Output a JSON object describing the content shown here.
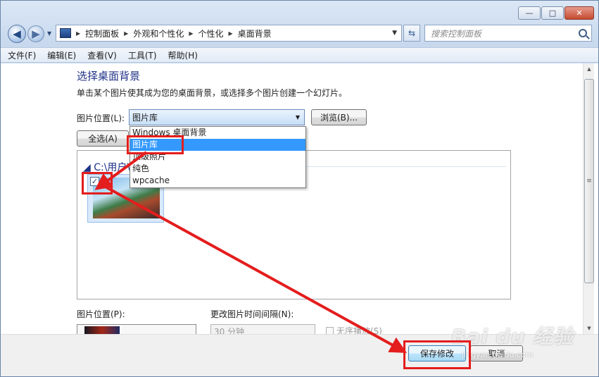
{
  "window": {
    "minimize_label": "—",
    "maximize_label": "□",
    "close_label": "✕"
  },
  "nav": {
    "breadcrumbs": [
      "控制面板",
      "外观和个性化",
      "个性化",
      "桌面背景"
    ],
    "search_placeholder": "搜索控制面板",
    "icons": [
      "back-arrow-icon",
      "forward-arrow-icon",
      "control-panel-icon",
      "refresh-icon",
      "search-icon"
    ]
  },
  "menu": [
    "文件(F)",
    "编辑(E)",
    "查看(V)",
    "工具(T)",
    "帮助(H)"
  ],
  "main": {
    "title": "选择桌面背景",
    "description": "单击某个图片使其成为您的桌面背景，或选择多个图片创建一个幻灯片。",
    "location_label": "图片位置(L):",
    "location_value": "图片库",
    "browse_label": "浏览(B)...",
    "select_all_label": "全选(A)",
    "folder_header": "C:\\用户\\",
    "dropdown_options": [
      "Windows 桌面背景",
      "图片库",
      "顶级照片",
      "纯色",
      "wpcache"
    ],
    "dropdown_selected_index": 1
  },
  "bottom": {
    "position_label": "图片位置(P):",
    "interval_label": "更改图片时间间隔(N):",
    "interval_value": "30 分钟",
    "shuffle_label": "无序播放(S)"
  },
  "footer": {
    "save_label": "保存修改",
    "cancel_label": "取消"
  },
  "watermark": {
    "brand": "Bai du 经验",
    "url": "jingyan.baidu.com"
  },
  "colors": {
    "annotation_red": "#e41d1d",
    "heading_blue": "#1e3287",
    "selection_blue": "#3399ff"
  }
}
